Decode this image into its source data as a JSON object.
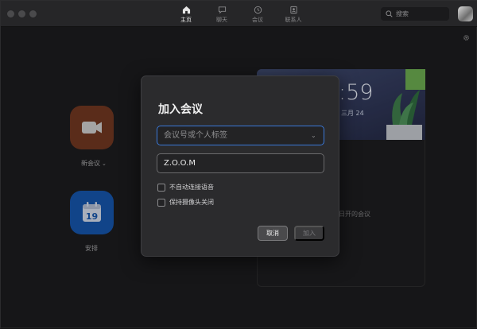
{
  "nav": {
    "home": "主页",
    "chat": "聊天",
    "meetings": "会议",
    "contacts": "联系人"
  },
  "search": {
    "placeholder": "搜索"
  },
  "home": {
    "new_meeting": "新会议",
    "schedule": "安排",
    "schedule_day": "19"
  },
  "panel": {
    "time": ":59",
    "date": "三月 24",
    "upcoming": "日开的会议"
  },
  "dialog": {
    "title": "加入会议",
    "meeting_id_placeholder": "会议号或个人标签",
    "name_value": "Z.O.O.M",
    "option_audio": "不自动连接语音",
    "option_video": "保持摄像头关闭",
    "cancel": "取消",
    "join": "加入"
  },
  "colors": {
    "accent": "#3a78d8",
    "new_meeting_tile": "#6e3620",
    "schedule_tile": "#1553a8"
  },
  "icons": {
    "home": "home-icon",
    "chat": "chat-icon",
    "meetings": "clock-icon",
    "contacts": "contacts-icon",
    "search": "search-icon",
    "settings": "gear-icon",
    "new_meeting": "video-camera-icon",
    "schedule": "calendar-icon"
  }
}
